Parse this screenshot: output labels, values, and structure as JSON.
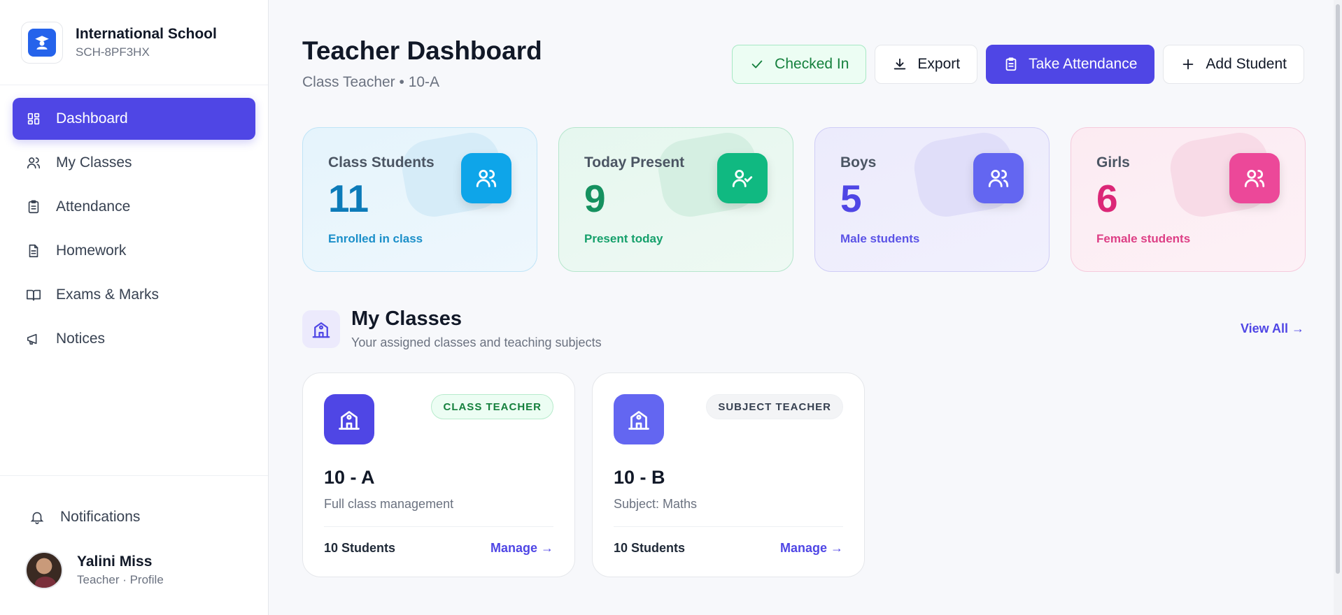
{
  "brand": {
    "name": "International School",
    "code": "SCH-8PF3HX"
  },
  "nav": {
    "items": [
      {
        "label": "Dashboard",
        "icon": "grid-icon",
        "active": true
      },
      {
        "label": "My Classes",
        "icon": "users-icon"
      },
      {
        "label": "Attendance",
        "icon": "clipboard-icon"
      },
      {
        "label": "Homework",
        "icon": "document-icon"
      },
      {
        "label": "Exams & Marks",
        "icon": "book-open-icon"
      },
      {
        "label": "Notices",
        "icon": "megaphone-icon"
      }
    ]
  },
  "sidebar_bottom": {
    "notifications_label": "Notifications"
  },
  "profile": {
    "name": "Yalini Miss",
    "role": "Teacher · Profile"
  },
  "header": {
    "title": "Teacher Dashboard",
    "subtitle": "Class Teacher • 10-A"
  },
  "actions": {
    "checked_in": "Checked In",
    "export": "Export",
    "take_attendance": "Take Attendance",
    "add_student": "Add Student"
  },
  "stats": [
    {
      "label": "Class Students",
      "value": "11",
      "note": "Enrolled in class",
      "color": "#0ea5e9"
    },
    {
      "label": "Today Present",
      "value": "9",
      "note": "Present today",
      "color": "#10b981"
    },
    {
      "label": "Boys",
      "value": "5",
      "note": "Male students",
      "color": "#6366f1"
    },
    {
      "label": "Girls",
      "value": "6",
      "note": "Female students",
      "color": "#ec4899"
    }
  ],
  "my_classes": {
    "title": "My Classes",
    "subtitle": "Your assigned classes and teaching subjects",
    "view_all": "View All →",
    "cards": [
      {
        "badge": "CLASS TEACHER",
        "name": "10 - A",
        "desc": "Full class management",
        "count": "10 Students",
        "manage": "Manage →"
      },
      {
        "badge": "SUBJECT TEACHER",
        "name": "10 - B",
        "desc": "Subject: Maths",
        "count": "10 Students",
        "manage": "Manage →"
      }
    ]
  },
  "colors": {
    "accent": "#4f46e5",
    "success": "#15803d"
  }
}
